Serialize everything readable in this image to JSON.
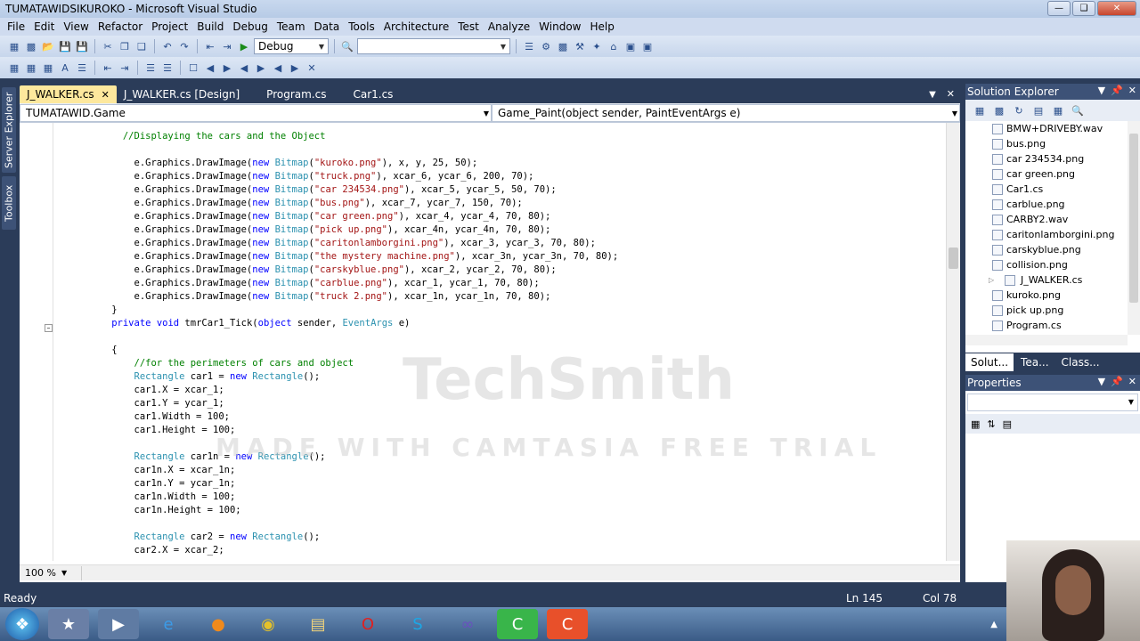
{
  "window": {
    "title": "TUMATAWIDSIKUROKO - Microsoft Visual Studio"
  },
  "menu": [
    "File",
    "Edit",
    "View",
    "Refactor",
    "Project",
    "Build",
    "Debug",
    "Team",
    "Data",
    "Tools",
    "Architecture",
    "Test",
    "Analyze",
    "Window",
    "Help"
  ],
  "toolbar": {
    "config": "Debug",
    "search_value": ""
  },
  "side_tabs": [
    "Server Explorer",
    "Toolbox"
  ],
  "doc_tabs": [
    {
      "label": "J_WALKER.cs",
      "active": true
    },
    {
      "label": "J_WALKER.cs [Design]"
    },
    {
      "label": "Program.cs"
    },
    {
      "label": "Car1.cs"
    }
  ],
  "nav": {
    "class_combo": "TUMATAWID.Game",
    "member_combo": "Game_Paint(object sender, PaintEventArgs e)"
  },
  "code_lines": [
    {
      "t": "            //Displaying the cars and the Object",
      "k": "cm"
    },
    {
      "t": "",
      "k": ""
    },
    {
      "t": "              e.Graphics.DrawImage(new Bitmap(\"kuroko.png\"), x, y, 25, 50);",
      "k": "draw"
    },
    {
      "t": "              e.Graphics.DrawImage(new Bitmap(\"truck.png\"), xcar_6, ycar_6, 200, 70);",
      "k": "draw"
    },
    {
      "t": "              e.Graphics.DrawImage(new Bitmap(\"car 234534.png\"), xcar_5, ycar_5, 50, 70);",
      "k": "draw"
    },
    {
      "t": "              e.Graphics.DrawImage(new Bitmap(\"bus.png\"), xcar_7, ycar_7, 150, 70);",
      "k": "draw"
    },
    {
      "t": "              e.Graphics.DrawImage(new Bitmap(\"car green.png\"), xcar_4, ycar_4, 70, 80);",
      "k": "draw"
    },
    {
      "t": "              e.Graphics.DrawImage(new Bitmap(\"pick up.png\"), xcar_4n, ycar_4n, 70, 80);",
      "k": "draw"
    },
    {
      "t": "              e.Graphics.DrawImage(new Bitmap(\"caritonlamborgini.png\"), xcar_3, ycar_3, 70, 80);",
      "k": "draw"
    },
    {
      "t": "              e.Graphics.DrawImage(new Bitmap(\"the mystery machine.png\"), xcar_3n, ycar_3n, 70, 80);",
      "k": "draw"
    },
    {
      "t": "              e.Graphics.DrawImage(new Bitmap(\"carskyblue.png\"), xcar_2, ycar_2, 70, 80);",
      "k": "draw"
    },
    {
      "t": "              e.Graphics.DrawImage(new Bitmap(\"carblue.png\"), xcar_1, ycar_1, 70, 80);",
      "k": "draw"
    },
    {
      "t": "              e.Graphics.DrawImage(new Bitmap(\"truck 2.png\"), xcar_1n, ycar_1n, 70, 80);",
      "k": "draw"
    },
    {
      "t": "          }",
      "k": ""
    },
    {
      "t": "          private void tmrCar1_Tick(object sender, EventArgs e)",
      "k": "method"
    },
    {
      "t": "",
      "k": ""
    },
    {
      "t": "          {",
      "k": ""
    },
    {
      "t": "              //for the perimeters of cars and object",
      "k": "cm"
    },
    {
      "t": "              Rectangle car1 = new Rectangle();",
      "k": "rect"
    },
    {
      "t": "              car1.X = xcar_1;",
      "k": ""
    },
    {
      "t": "              car1.Y = ycar_1;",
      "k": ""
    },
    {
      "t": "              car1.Width = 100;",
      "k": ""
    },
    {
      "t": "              car1.Height = 100;",
      "k": ""
    },
    {
      "t": "",
      "k": ""
    },
    {
      "t": "              Rectangle car1n = new Rectangle();",
      "k": "rect"
    },
    {
      "t": "              car1n.X = xcar_1n;",
      "k": ""
    },
    {
      "t": "              car1n.Y = ycar_1n;",
      "k": ""
    },
    {
      "t": "              car1n.Width = 100;",
      "k": ""
    },
    {
      "t": "              car1n.Height = 100;",
      "k": ""
    },
    {
      "t": "",
      "k": ""
    },
    {
      "t": "              Rectangle car2 = new Rectangle();",
      "k": "rect"
    },
    {
      "t": "              car2.X = xcar_2;",
      "k": ""
    }
  ],
  "zoom": "100 %",
  "watermark": {
    "line1": "TechSmith",
    "line2": "MADE WITH CAMTASIA FREE TRIAL"
  },
  "solution_explorer": {
    "title": "Solution Explorer",
    "items": [
      "BMW+DRIVEBY.wav",
      "bus.png",
      "car 234534.png",
      "car green.png",
      "Car1.cs",
      "carblue.png",
      "CARBY2.wav",
      "caritonlamborgini.png",
      "carskyblue.png",
      "collision.png",
      "J_WALKER.cs",
      "kuroko.png",
      "pick up.png",
      "Program.cs"
    ],
    "tabs": [
      "Solut...",
      "Tea...",
      "Class..."
    ]
  },
  "properties": {
    "title": "Properties"
  },
  "status": {
    "text": "Ready",
    "ln": "Ln 145",
    "col": "Col 78"
  }
}
